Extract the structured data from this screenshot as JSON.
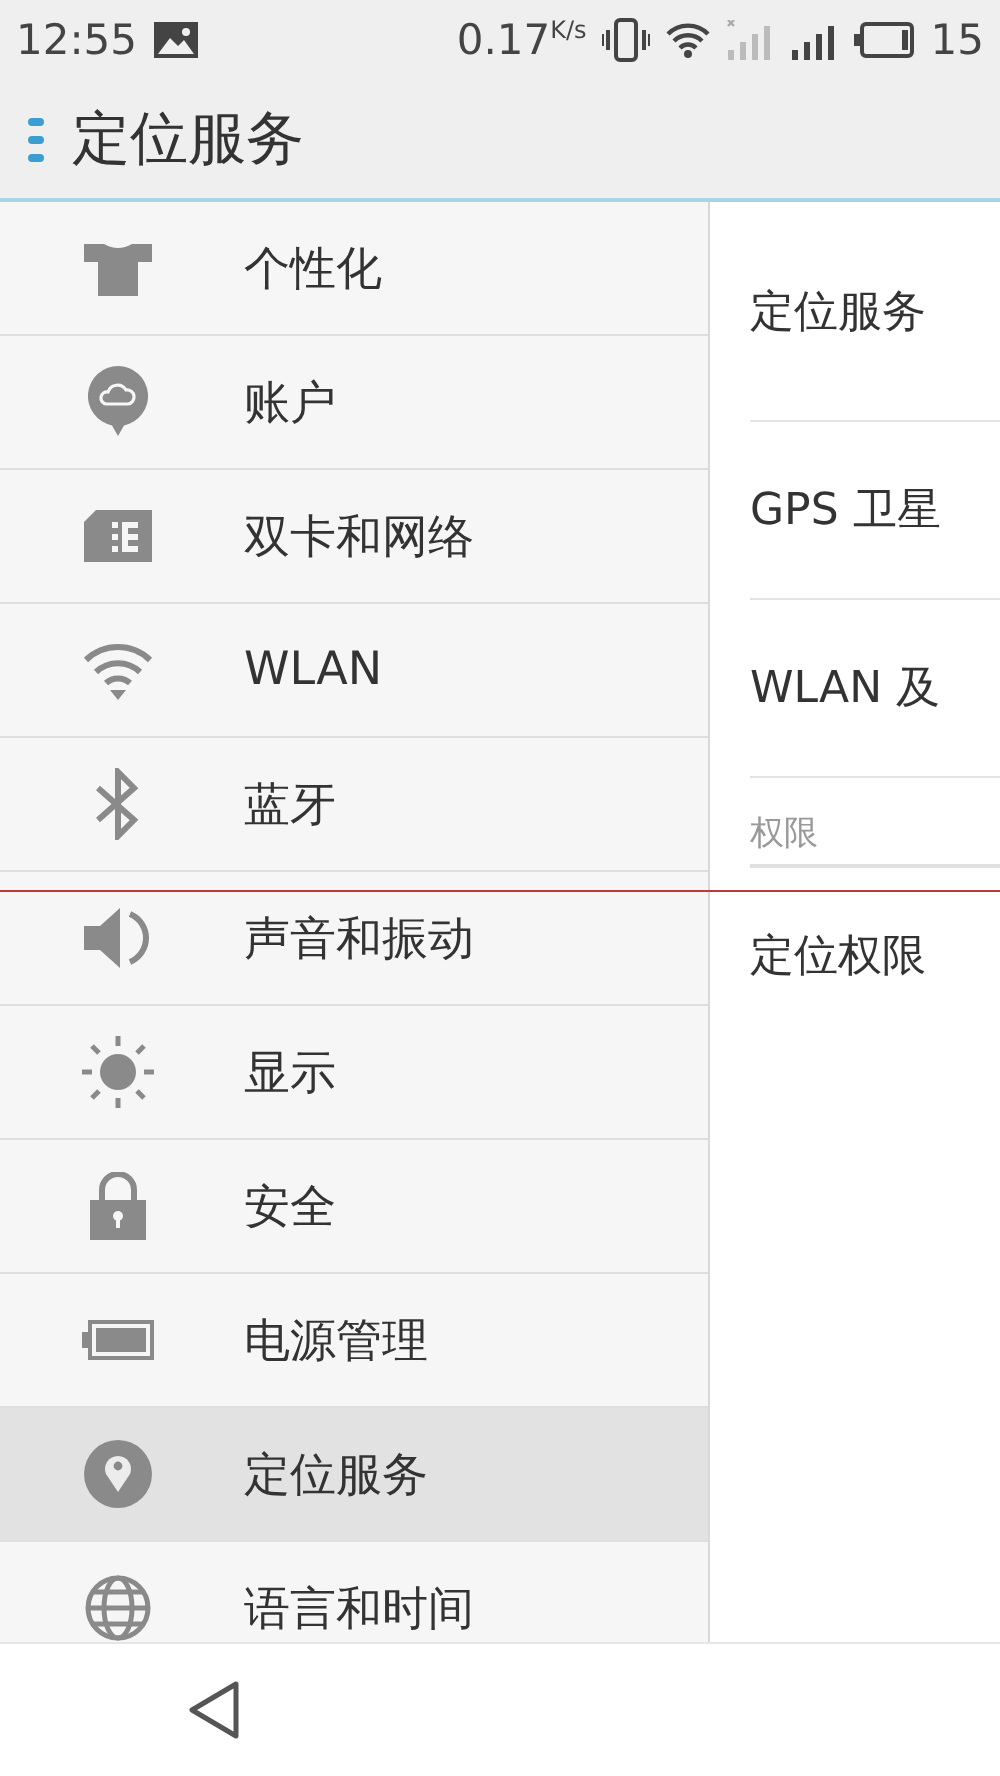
{
  "status_bar": {
    "time": "12:55",
    "speed": "0.17",
    "speed_unit": "K/s",
    "battery": "15"
  },
  "header": {
    "title": "定位服务"
  },
  "sidebar": {
    "items": [
      {
        "label": "个性化",
        "selected": false
      },
      {
        "label": "账户",
        "selected": false
      },
      {
        "label": "双卡和网络",
        "selected": false
      },
      {
        "label": "WLAN",
        "selected": false
      },
      {
        "label": "蓝牙",
        "selected": false
      },
      {
        "label": "声音和振动",
        "selected": false
      },
      {
        "label": "显示",
        "selected": false
      },
      {
        "label": "安全",
        "selected": false
      },
      {
        "label": "电源管理",
        "selected": false
      },
      {
        "label": "定位服务",
        "selected": true
      },
      {
        "label": "语言和时间",
        "selected": false
      }
    ]
  },
  "detail": {
    "items": [
      {
        "kind": "item",
        "label": "定位服务"
      },
      {
        "kind": "item",
        "label": "GPS 卫星"
      },
      {
        "kind": "item",
        "label": "WLAN 及"
      },
      {
        "kind": "header",
        "label": "权限"
      },
      {
        "kind": "item",
        "label": "定位权限"
      }
    ]
  }
}
